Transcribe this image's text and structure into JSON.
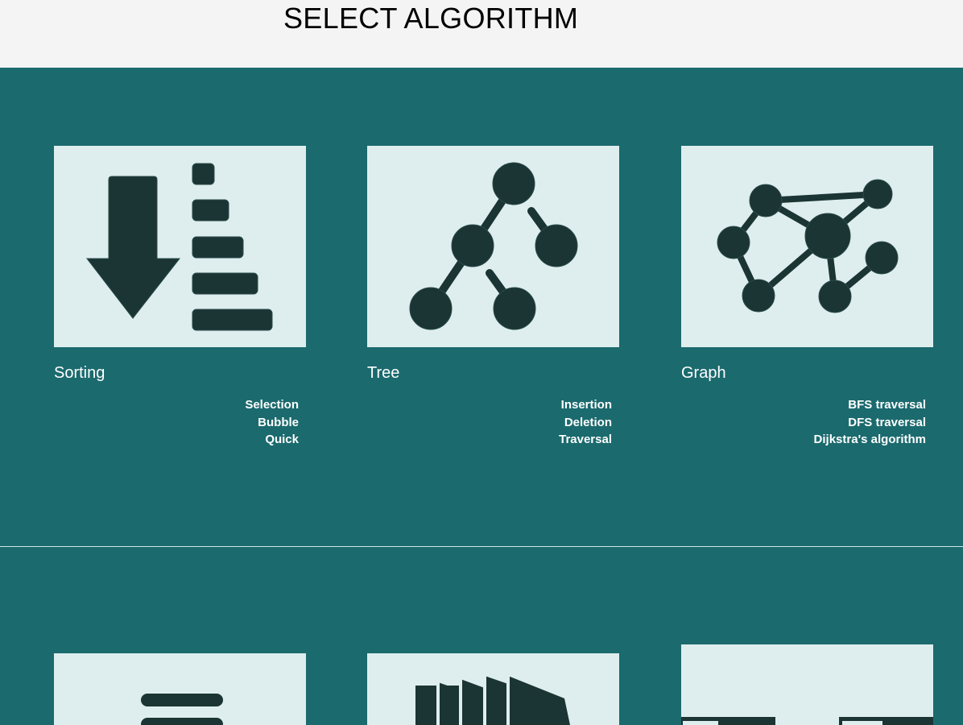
{
  "header": {
    "title": "SELECT ALGORITHM"
  },
  "cards": [
    {
      "title": "Sorting",
      "icon": "sort-descending-icon",
      "links": [
        "Selection",
        "Bubble",
        "Quick"
      ]
    },
    {
      "title": "Tree",
      "icon": "tree-structure-icon",
      "links": [
        "Insertion",
        "Deletion",
        "Traversal"
      ]
    },
    {
      "title": "Graph",
      "icon": "graph-network-icon",
      "links": [
        "BFS traversal",
        "DFS traversal",
        "Dijkstra's algorithm"
      ]
    }
  ],
  "row2_icons": [
    "stack-lines-icon",
    "stacked-layers-icon",
    "blocks-icon"
  ],
  "colors": {
    "background": "#1b6a6e",
    "header": "#f4f4f4",
    "tile": "#deeeee",
    "icon": "#1b3434"
  }
}
